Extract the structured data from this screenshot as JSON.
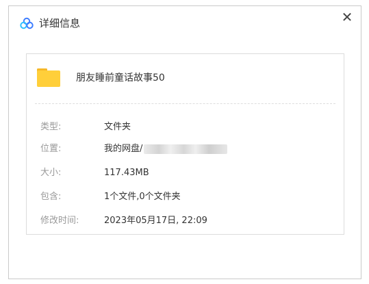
{
  "dialog": {
    "title": "详细信息",
    "close_label": "✕"
  },
  "file": {
    "name": "朋友睡前童话故事50",
    "icon": "folder-icon"
  },
  "details": [
    {
      "label": "类型:",
      "value": "文件夹"
    },
    {
      "label": "位置:",
      "value": "我的网盘/"
    },
    {
      "label": "大小:",
      "value": "117.43MB"
    },
    {
      "label": "包含:",
      "value": "1个文件,0个文件夹"
    },
    {
      "label": "修改时间:",
      "value": "2023年05月17日, 22:09"
    }
  ],
  "colors": {
    "accent": "#3d7dff",
    "folder": "#ffcf3a",
    "label": "#999999"
  }
}
